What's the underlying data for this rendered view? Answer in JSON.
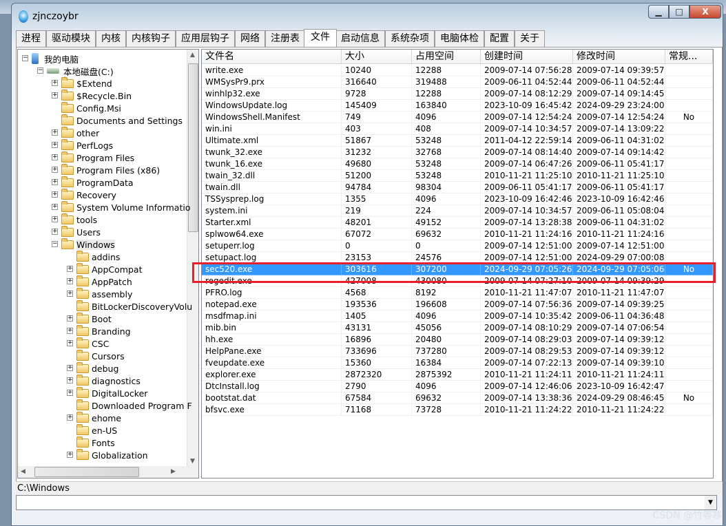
{
  "window": {
    "title": "zjnczoybr",
    "min": "▁",
    "max": "□",
    "close": "X"
  },
  "tabs": [
    "进程",
    "驱动模块",
    "内核",
    "内核钩子",
    "应用层钩子",
    "网络",
    "注册表",
    "文件",
    "启动信息",
    "系统杂项",
    "电脑体检",
    "配置",
    "关于"
  ],
  "active_tab": "文件",
  "tree": {
    "root": "我的电脑",
    "drive": "本地磁盘(C:)",
    "items": [
      {
        "label": "$Extend",
        "level": 2,
        "expand": "+"
      },
      {
        "label": "$Recycle.Bin",
        "level": 2,
        "expand": "+"
      },
      {
        "label": "Config.Msi",
        "level": 2,
        "expand": ""
      },
      {
        "label": "Documents and Settings",
        "level": 2,
        "expand": ""
      },
      {
        "label": "other",
        "level": 2,
        "expand": "+"
      },
      {
        "label": "PerfLogs",
        "level": 2,
        "expand": "+"
      },
      {
        "label": "Program Files",
        "level": 2,
        "expand": "+"
      },
      {
        "label": "Program Files (x86)",
        "level": 2,
        "expand": "+"
      },
      {
        "label": "ProgramData",
        "level": 2,
        "expand": "+"
      },
      {
        "label": "Recovery",
        "level": 2,
        "expand": "+"
      },
      {
        "label": "System Volume Informatio",
        "level": 2,
        "expand": "+"
      },
      {
        "label": "tools",
        "level": 2,
        "expand": "+"
      },
      {
        "label": "Users",
        "level": 2,
        "expand": "+"
      },
      {
        "label": "Windows",
        "level": 2,
        "expand": "-",
        "selected": true
      },
      {
        "label": "addins",
        "level": 3,
        "expand": ""
      },
      {
        "label": "AppCompat",
        "level": 3,
        "expand": "+"
      },
      {
        "label": "AppPatch",
        "level": 3,
        "expand": "+"
      },
      {
        "label": "assembly",
        "level": 3,
        "expand": "+"
      },
      {
        "label": "BitLockerDiscoveryVolu",
        "level": 3,
        "expand": ""
      },
      {
        "label": "Boot",
        "level": 3,
        "expand": "+"
      },
      {
        "label": "Branding",
        "level": 3,
        "expand": "+"
      },
      {
        "label": "CSC",
        "level": 3,
        "expand": "+"
      },
      {
        "label": "Cursors",
        "level": 3,
        "expand": ""
      },
      {
        "label": "debug",
        "level": 3,
        "expand": "+"
      },
      {
        "label": "diagnostics",
        "level": 3,
        "expand": "+"
      },
      {
        "label": "DigitalLocker",
        "level": 3,
        "expand": "+"
      },
      {
        "label": "Downloaded Program F",
        "level": 3,
        "expand": ""
      },
      {
        "label": "ehome",
        "level": 3,
        "expand": "+"
      },
      {
        "label": "en-US",
        "level": 3,
        "expand": ""
      },
      {
        "label": "Fonts",
        "level": 3,
        "expand": ""
      },
      {
        "label": "Globalization",
        "level": 3,
        "expand": "+"
      }
    ]
  },
  "table": {
    "columns": [
      "文件名",
      "大小",
      "占用空间",
      "创建时间",
      "修改时间",
      "常规..."
    ],
    "rows": [
      [
        "write.exe",
        "10240",
        "12288",
        "2009-07-14 07:56:28",
        "2009-07-14 09:39:57",
        ""
      ],
      [
        "WMSysPr9.prx",
        "316640",
        "319488",
        "2009-06-11 04:52:44",
        "2009-06-11 04:52:44",
        ""
      ],
      [
        "winhlp32.exe",
        "9728",
        "12288",
        "2009-07-14 08:12:29",
        "2009-07-14 09:14:45",
        ""
      ],
      [
        "WindowsUpdate.log",
        "145409",
        "163840",
        "2023-10-09 16:45:42",
        "2024-09-29 23:24:00",
        ""
      ],
      [
        "WindowsShell.Manifest",
        "749",
        "4096",
        "2009-07-14 12:54:24",
        "2009-07-14 12:54:24",
        "No"
      ],
      [
        "win.ini",
        "403",
        "408",
        "2009-07-14 10:34:57",
        "2009-07-14 13:09:22",
        ""
      ],
      [
        "Ultimate.xml",
        "51867",
        "53248",
        "2011-04-12 22:59:14",
        "2009-06-11 04:31:02",
        ""
      ],
      [
        "twunk_32.exe",
        "31232",
        "32768",
        "2009-07-14 08:14:40",
        "2009-07-14 09:14:42",
        ""
      ],
      [
        "twunk_16.exe",
        "49680",
        "53248",
        "2009-07-14 06:47:26",
        "2009-06-11 05:41:17",
        ""
      ],
      [
        "twain_32.dll",
        "51200",
        "53248",
        "2010-11-21 11:25:10",
        "2010-11-21 11:25:10",
        ""
      ],
      [
        "twain.dll",
        "94784",
        "98304",
        "2009-06-11 05:41:17",
        "2009-06-11 05:41:17",
        ""
      ],
      [
        "TSSysprep.log",
        "1355",
        "4096",
        "2023-10-09 16:42:46",
        "2023-10-09 16:42:46",
        ""
      ],
      [
        "system.ini",
        "219",
        "224",
        "2009-07-14 10:34:57",
        "2009-06-11 05:08:04",
        ""
      ],
      [
        "Starter.xml",
        "48201",
        "49152",
        "2009-07-14 13:28:38",
        "2009-06-11 04:31:02",
        ""
      ],
      [
        "splwow64.exe",
        "67072",
        "69632",
        "2010-11-21 11:24:16",
        "2010-11-21 11:24:16",
        ""
      ],
      [
        "setuperr.log",
        "0",
        "0",
        "2009-07-14 12:51:00",
        "2009-07-14 12:51:00",
        ""
      ],
      [
        "setupact.log",
        "23153",
        "24576",
        "2009-07-14 12:51:00",
        "2024-09-29 07:00:08",
        ""
      ],
      [
        "sec520.exe",
        "303616",
        "307200",
        "2024-09-29 07:05:26",
        "2024-09-29 07:05:06",
        "No"
      ],
      [
        "regedit.exe",
        "427008",
        "430080",
        "2009-07-14 07:27:10",
        "2009-07-14 09:39:29",
        ""
      ],
      [
        "PFRO.log",
        "4568",
        "8192",
        "2010-11-21 11:47:07",
        "2010-11-21 11:47:07",
        ""
      ],
      [
        "notepad.exe",
        "193536",
        "196608",
        "2009-07-14 07:56:36",
        "2009-07-14 09:39:25",
        ""
      ],
      [
        "msdfmap.ini",
        "1405",
        "4096",
        "2009-07-14 10:35:42",
        "2009-06-11 04:36:48",
        ""
      ],
      [
        "mib.bin",
        "43131",
        "45056",
        "2009-07-14 08:10:29",
        "2009-07-14 07:06:54",
        ""
      ],
      [
        "hh.exe",
        "16896",
        "20480",
        "2009-07-14 08:29:03",
        "2009-07-14 09:39:12",
        ""
      ],
      [
        "HelpPane.exe",
        "733696",
        "737280",
        "2009-07-14 08:29:53",
        "2009-07-14 09:39:12",
        ""
      ],
      [
        "fveupdate.exe",
        "15360",
        "16384",
        "2009-07-14 07:22:13",
        "2009-07-14 09:39:10",
        ""
      ],
      [
        "explorer.exe",
        "2872320",
        "2875392",
        "2010-11-21 11:24:11",
        "2010-11-21 11:24:11",
        ""
      ],
      [
        "DtcInstall.log",
        "2790",
        "4096",
        "2009-07-14 12:46:06",
        "2023-10-09 16:42:47",
        ""
      ],
      [
        "bootstat.dat",
        "67584",
        "69632",
        "2009-07-14 13:38:36",
        "2024-09-29 08:46:45",
        "No"
      ],
      [
        "bfsvc.exe",
        "71168",
        "73728",
        "2010-11-21 11:24:22",
        "2010-11-21 11:24:22",
        ""
      ]
    ],
    "selected_row": 17
  },
  "status": {
    "path": "C:\\Windows"
  },
  "colors": {
    "selection": "#3399ff",
    "highlight_box": "#e8202a"
  },
  "watermark": "CSDN @竹等寒"
}
